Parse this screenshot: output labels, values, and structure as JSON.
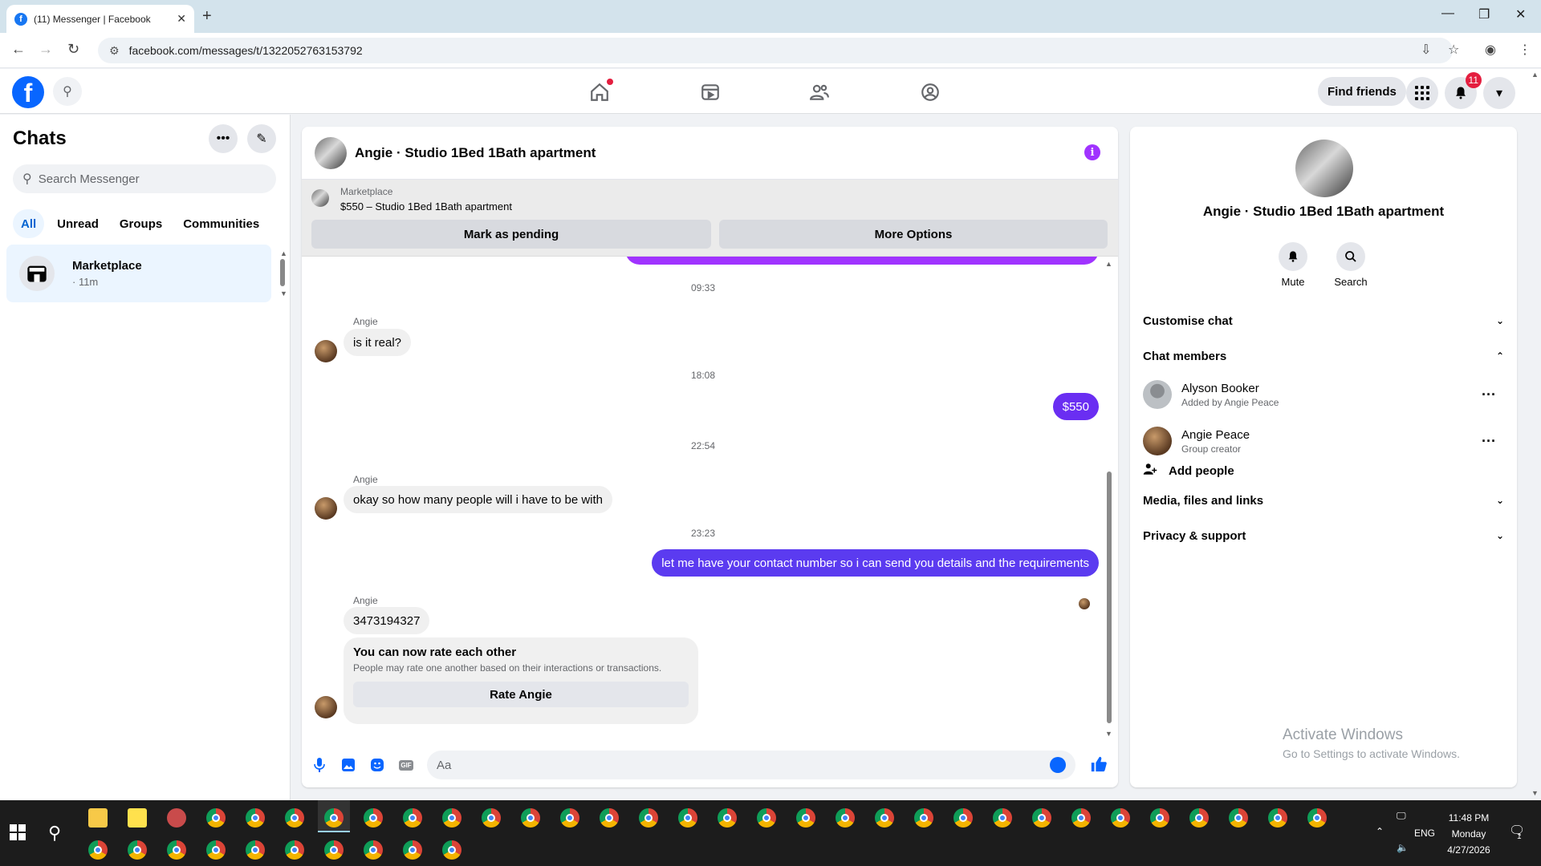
{
  "browser": {
    "tab_title": "(11) Messenger | Facebook",
    "tab_favicon": "f",
    "url": "facebook.com/messages/t/1322052763153792"
  },
  "fb_header": {
    "find_friends": "Find friends",
    "notification_count": "11"
  },
  "chat_list": {
    "title": "Chats",
    "search_placeholder": "Search Messenger",
    "filters": [
      "All",
      "Unread",
      "Groups",
      "Communities"
    ],
    "active_filter": "All",
    "items": [
      {
        "name": "Marketplace",
        "time": "· 11m"
      }
    ]
  },
  "conversation": {
    "title": "Angie · Studio 1Bed 1Bath apartment",
    "marketplace_banner": {
      "label": "Marketplace",
      "listing": "$550 – Studio 1Bed 1Bath apartment",
      "btn_pending": "Mark as pending",
      "btn_more": "More Options"
    },
    "messages": {
      "ts1": "09:33",
      "m1_sender": "Angie",
      "m1_text": "is it real?",
      "ts2": "18:08",
      "m2_text": "$550",
      "ts3": "22:54",
      "m3_sender": "Angie",
      "m3_text": "okay so how many people will i have to be with",
      "ts4": "23:23",
      "m4_text": "let me have your contact number so i can send you details and the requirements",
      "m5_sender": "Angie",
      "m5_text": "3473194327",
      "rate_title": "You can now rate each other",
      "rate_sub": "People may rate one another based on their interactions or transactions.",
      "rate_btn": "Rate Angie"
    },
    "composer_placeholder": "Aa",
    "gif_label": "GIF"
  },
  "info_panel": {
    "name": "Angie · Studio 1Bed 1Bath apartment",
    "actions": [
      {
        "label": "Mute",
        "icon": "bell-icon"
      },
      {
        "label": "Search",
        "icon": "search-icon"
      }
    ],
    "customise_chat": "Customise chat",
    "chat_members": "Chat members",
    "members": [
      {
        "name": "Alyson Booker",
        "sub": "Added by Angie Peace"
      },
      {
        "name": "Angie Peace",
        "sub": "Group creator"
      }
    ],
    "add_people": "Add people",
    "media_files": "Media, files and links",
    "privacy": "Privacy & support"
  },
  "watermark": {
    "line1": "Activate Windows",
    "line2": "Go to Settings to activate Windows."
  },
  "taskbar": {
    "lang": "ENG",
    "time": "11:48 PM",
    "day": "Monday",
    "date": "4/27/2026",
    "notif_count": "1"
  },
  "colors": {
    "fb_blue": "#0866ff",
    "messenger_purple": "#a033ff",
    "outgoing_bubble": "#6a2ef2",
    "badge_red": "#e41e3f"
  }
}
